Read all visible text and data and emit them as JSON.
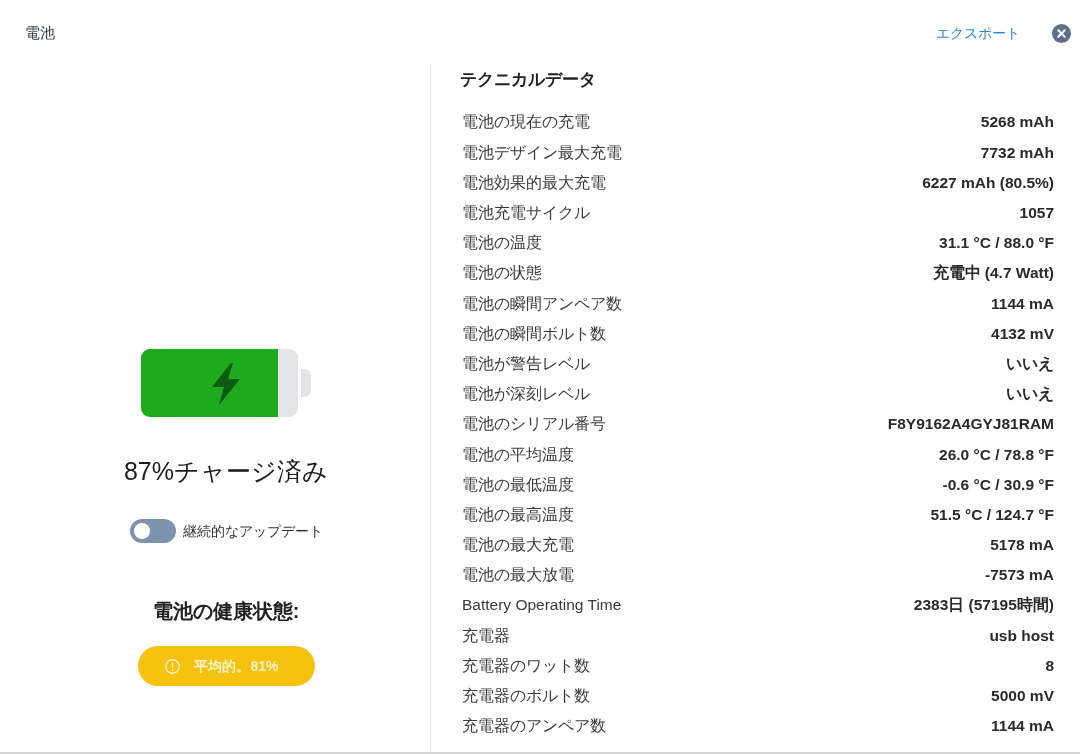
{
  "header": {
    "title": "電池",
    "export_link": "エクスポート"
  },
  "battery": {
    "level": 0.87,
    "charging": true,
    "charge_text": "87%チャージ済み"
  },
  "continuous_update": {
    "label": "継続的なアップデート",
    "on": false
  },
  "health": {
    "title": "電池の健康状態:",
    "status": "平均的。81%",
    "kind": "average"
  },
  "technical_data": {
    "title": "テクニカルデータ",
    "rows": [
      {
        "label": "電池の現在の充電",
        "value": "5268 mAh"
      },
      {
        "label": "電池デザイン最大充電",
        "value": "7732 mAh"
      },
      {
        "label": "電池効果的最大充電",
        "value": "6227 mAh (80.5%)"
      },
      {
        "label": "電池充電サイクル",
        "value": "1057"
      },
      {
        "label": "電池の温度",
        "value": "31.1 °C / 88.0 °F"
      },
      {
        "label": "電池の状態",
        "value": "充電中 (4.7 Watt)"
      },
      {
        "label": "電池の瞬間アンペア数",
        "value": "1144 mA"
      },
      {
        "label": "電池の瞬間ボルト数",
        "value": "4132 mV"
      },
      {
        "label": "電池が警告レベル",
        "value": "いいえ"
      },
      {
        "label": "電池が深刻レベル",
        "value": "いいえ"
      },
      {
        "label": "電池のシリアル番号",
        "value": "F8Y9162A4GYJ81RAM"
      },
      {
        "label": "電池の平均温度",
        "value": "26.0 °C / 78.8 °F"
      },
      {
        "label": "電池の最低温度",
        "value": "-0.6 °C / 30.9 °F"
      },
      {
        "label": "電池の最高温度",
        "value": "51.5 °C / 124.7 °F"
      },
      {
        "label": "電池の最大充電",
        "value": "5178 mA"
      },
      {
        "label": "電池の最大放電",
        "value": "-7573 mA"
      },
      {
        "label": "Battery Operating Time",
        "value": "2383日 (57195時間)"
      },
      {
        "label": "充電器",
        "value": "usb host"
      },
      {
        "label": "充電器のワット数",
        "value": "8"
      },
      {
        "label": "充電器のボルト数",
        "value": "5000 mV"
      },
      {
        "label": "充電器のアンペア数",
        "value": "1144 mA"
      }
    ]
  }
}
